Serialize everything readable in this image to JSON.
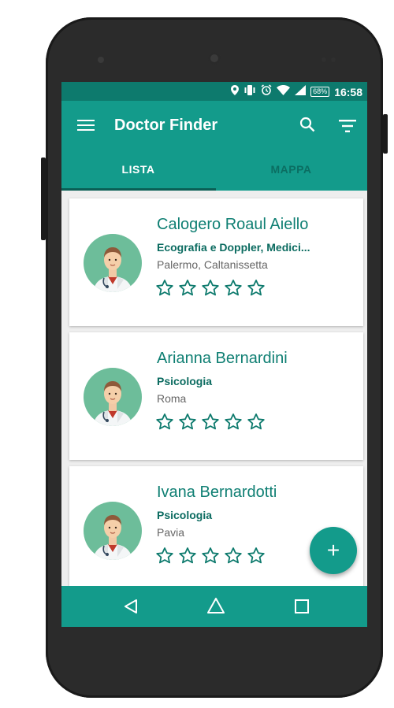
{
  "status_bar": {
    "battery": "68%",
    "time": "16:58",
    "icons": [
      "location-icon",
      "vibrate-icon",
      "alarm-icon",
      "wifi-icon",
      "signal-icon",
      "battery-icon"
    ]
  },
  "toolbar": {
    "title": "Doctor Finder",
    "menu_icon": "hamburger-menu-icon",
    "search_icon": "search-icon",
    "filter_icon": "filter-icon"
  },
  "tabs": [
    {
      "label": "LISTA",
      "selected": true
    },
    {
      "label": "MAPPA",
      "selected": false
    }
  ],
  "doctors": [
    {
      "name": "Calogero Roaul Aiello",
      "specialty": "Ecografia e Doppler, Medici...",
      "location": "Palermo, Caltanissetta",
      "rating": 0,
      "max_rating": 5
    },
    {
      "name": "Arianna Bernardini",
      "specialty": "Psicologia",
      "location": "Roma",
      "rating": 0,
      "max_rating": 5
    },
    {
      "name": "Ivana Bernardotti",
      "specialty": "Psicologia",
      "location": "Pavia",
      "rating": 0,
      "max_rating": 5
    }
  ],
  "fab": {
    "label": "+",
    "icon": "add-icon"
  },
  "nav_bar": {
    "icons": [
      "back-icon",
      "home-icon",
      "recent-apps-icon"
    ]
  },
  "colors": {
    "primary": "#139b8b",
    "primary_dark": "#0d7a6d",
    "accent_text": "#0f7f73",
    "background": "#eeeeee"
  }
}
